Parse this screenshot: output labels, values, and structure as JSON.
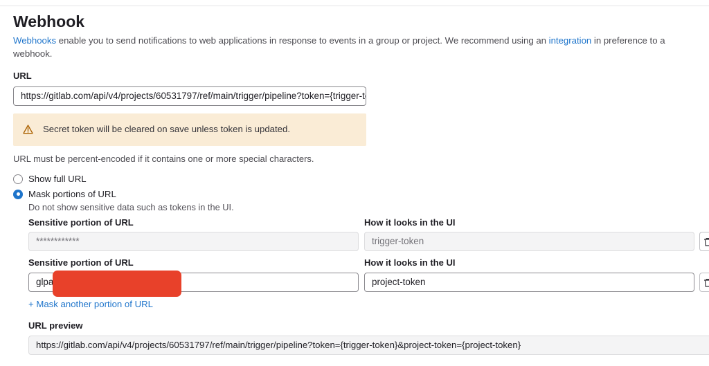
{
  "page": {
    "title": "Webhook",
    "intro": {
      "link1": "Webhooks",
      "text1": " enable you to send notifications to web applications in response to events in a group or project. We recommend using an ",
      "link2": "integration",
      "text2": " in preference to a webhook."
    }
  },
  "url_section": {
    "label": "URL",
    "value": "https://gitlab.com/api/v4/projects/60531797/ref/main/trigger/pipeline?token={trigger-token}&project-token={project-token}"
  },
  "alert": {
    "icon": "warning-icon",
    "text": "Secret token will be cleared on save unless token is updated."
  },
  "help_text": "URL must be percent-encoded if it contains one or more special characters.",
  "radio": {
    "show_full": "Show full URL",
    "mask": "Mask portions of URL",
    "mask_help": "Do not show sensitive data such as tokens in the UI.",
    "selected": "mask"
  },
  "masks": [
    {
      "sensitive_label": "Sensitive portion of URL",
      "sensitive_value": "************",
      "ui_label": "How it looks in the UI",
      "ui_value": "trigger-token",
      "disabled": true
    },
    {
      "sensitive_label": "Sensitive portion of URL",
      "sensitive_value": "glpa",
      "ui_label": "How it looks in the UI",
      "ui_value": "project-token",
      "disabled": false
    }
  ],
  "add_mask": "+ Mask another portion of URL",
  "preview": {
    "label": "URL preview",
    "value": "https://gitlab.com/api/v4/projects/60531797/ref/main/trigger/pipeline?token={trigger-token}&project-token={project-token}"
  },
  "colors": {
    "link": "#1f75cb",
    "alert_bg": "#faecd6",
    "warning_icon": "#ab6100",
    "redaction": "#e8412a"
  }
}
